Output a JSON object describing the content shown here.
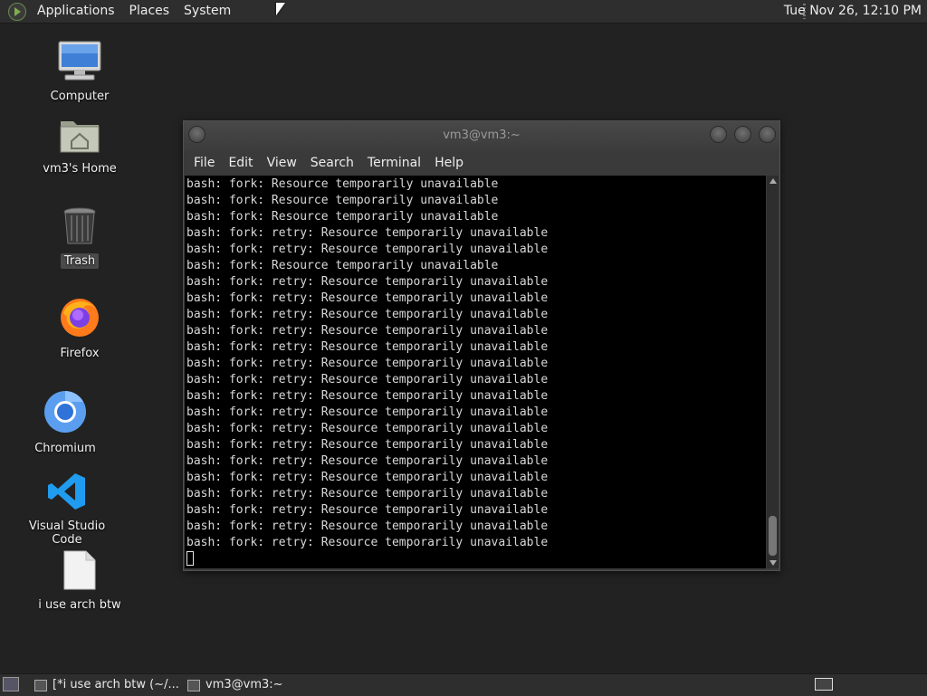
{
  "top_panel": {
    "menus": [
      "Applications",
      "Places",
      "System"
    ],
    "clock": "Tue Nov 26, 12:10 PM"
  },
  "desktop_icons": [
    {
      "label": "Computer",
      "icon": "computer-icon"
    },
    {
      "label": "vm3's Home",
      "icon": "home-folder-icon"
    },
    {
      "label": "Trash",
      "icon": "trash-icon"
    },
    {
      "label": "Firefox",
      "icon": "firefox-icon"
    },
    {
      "label": "Chromium",
      "icon": "chromium-icon"
    },
    {
      "label": "Visual Studio Code",
      "icon": "vscode-icon"
    },
    {
      "label": "i use arch btw",
      "icon": "text-file-icon"
    }
  ],
  "terminal_window": {
    "title": "vm3@vm3:~",
    "menu": [
      "File",
      "Edit",
      "View",
      "Search",
      "Terminal",
      "Help"
    ],
    "lines": [
      "bash: fork: Resource temporarily unavailable",
      "bash: fork: Resource temporarily unavailable",
      "bash: fork: Resource temporarily unavailable",
      "bash: fork: retry: Resource temporarily unavailable",
      "bash: fork: retry: Resource temporarily unavailable",
      "bash: fork: Resource temporarily unavailable",
      "bash: fork: retry: Resource temporarily unavailable",
      "bash: fork: retry: Resource temporarily unavailable",
      "bash: fork: retry: Resource temporarily unavailable",
      "bash: fork: retry: Resource temporarily unavailable",
      "bash: fork: retry: Resource temporarily unavailable",
      "bash: fork: retry: Resource temporarily unavailable",
      "bash: fork: retry: Resource temporarily unavailable",
      "bash: fork: retry: Resource temporarily unavailable",
      "bash: fork: retry: Resource temporarily unavailable",
      "bash: fork: retry: Resource temporarily unavailable",
      "bash: fork: retry: Resource temporarily unavailable",
      "bash: fork: retry: Resource temporarily unavailable",
      "bash: fork: retry: Resource temporarily unavailable",
      "bash: fork: retry: Resource temporarily unavailable",
      "bash: fork: retry: Resource temporarily unavailable",
      "bash: fork: retry: Resource temporarily unavailable",
      "bash: fork: retry: Resource temporarily unavailable"
    ]
  },
  "taskbar": {
    "tasks": [
      "[*i use arch btw (~/...",
      "vm3@vm3:~"
    ]
  }
}
